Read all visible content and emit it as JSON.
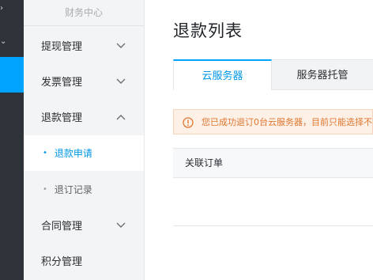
{
  "sidebar": {
    "title": "财务中心",
    "items": [
      {
        "label": "提现管理",
        "expanded": false
      },
      {
        "label": "发票管理",
        "expanded": false
      },
      {
        "label": "退款管理",
        "expanded": true
      },
      {
        "label": "合同管理",
        "expanded": false
      },
      {
        "label": "积分管理"
      }
    ],
    "subitems": [
      {
        "label": "退款申请",
        "active": true
      },
      {
        "label": "退订记录",
        "active": false
      }
    ]
  },
  "main": {
    "title": "退款列表",
    "tabs": [
      {
        "label": "云服务器",
        "active": true
      },
      {
        "label": "服务器托管",
        "active": false
      }
    ],
    "notice": {
      "icon": "warning-circle-icon",
      "text": "您已成功退订0台云服务器，目前只能选择不"
    },
    "table": {
      "headers": [
        "关联订单"
      ]
    }
  },
  "colors": {
    "accent": "#00a4ff",
    "warning": "#e0762f",
    "rail": "#2e3339"
  }
}
